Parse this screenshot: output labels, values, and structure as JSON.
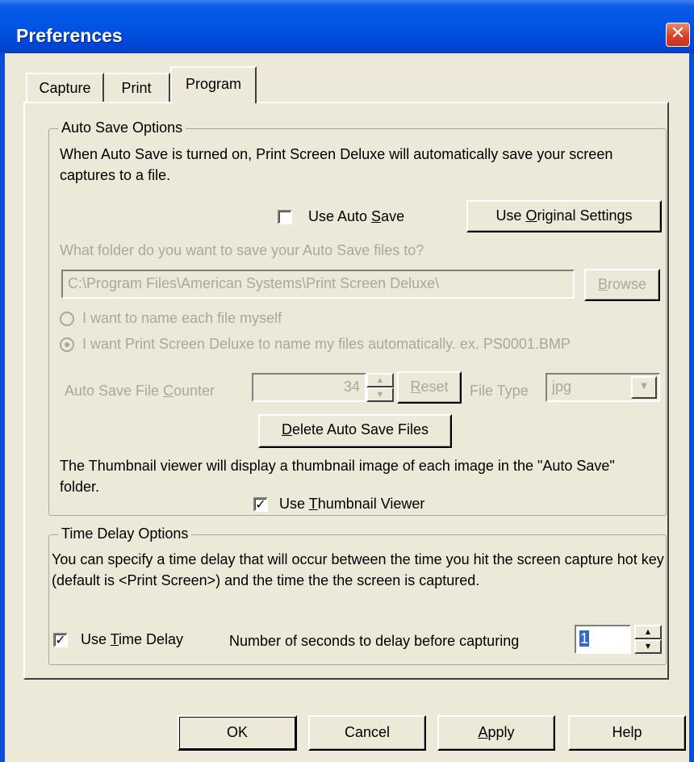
{
  "window": {
    "title": "Preferences",
    "close_glyph": "✕"
  },
  "tabs": [
    {
      "label": "Capture"
    },
    {
      "label": "Print"
    },
    {
      "label": "Program"
    }
  ],
  "active_tab": "Program",
  "auto_save": {
    "group_label": "Auto Save Options",
    "description": "When Auto Save is turned on, Print Screen Deluxe will automatically save your screen captures to a file.",
    "use_auto_save_label": "Use Auto Save",
    "use_auto_save_checked": false,
    "use_original_settings_label": "Use Original Settings",
    "folder_question": "What folder do you want to save your Auto Save files to?",
    "folder_path": "C:\\Program Files\\American Systems\\Print Screen Deluxe\\",
    "browse_label": "Browse",
    "radio_name_myself": "I want to name each file myself",
    "radio_name_auto": "I want Print Screen Deluxe to name my files automatically. ex. PS0001.BMP",
    "selected_naming": "auto",
    "file_counter_label": "Auto Save File Counter",
    "file_counter_value": "34",
    "reset_label": "Reset",
    "file_type_label": "File Type",
    "file_type_value": "jpg",
    "delete_files_label": "Delete Auto Save Files",
    "thumbnail_description": "The Thumbnail viewer will display a thumbnail image of each image in the \"Auto Save\" folder.",
    "use_thumbnail_viewer_label": "Use Thumbnail Viewer",
    "use_thumbnail_viewer_checked": true
  },
  "time_delay": {
    "group_label": "Time Delay Options",
    "description": "You can specify a time delay that will occur between the time you hit the screen capture hot key (default is <Print Screen>) and the time the the screen is captured.",
    "use_time_delay_label": "Use Time Delay",
    "use_time_delay_checked": true,
    "seconds_label": "Number of seconds to delay before capturing",
    "seconds_value": "1"
  },
  "footer": {
    "ok_label": "OK",
    "cancel_label": "Cancel",
    "apply_label": "Apply",
    "help_label": "Help"
  },
  "colors": {
    "titlebar": "#0055e5",
    "dialog_bg": "#ece9d8",
    "disabled_text": "#aca899",
    "close_button": "#d6432a"
  },
  "icons": {
    "close": "close-icon",
    "spin_up": "spin-up-arrow-icon",
    "spin_down": "spin-down-arrow-icon",
    "dropdown": "dropdown-arrow-icon",
    "check": "checkmark-icon"
  }
}
